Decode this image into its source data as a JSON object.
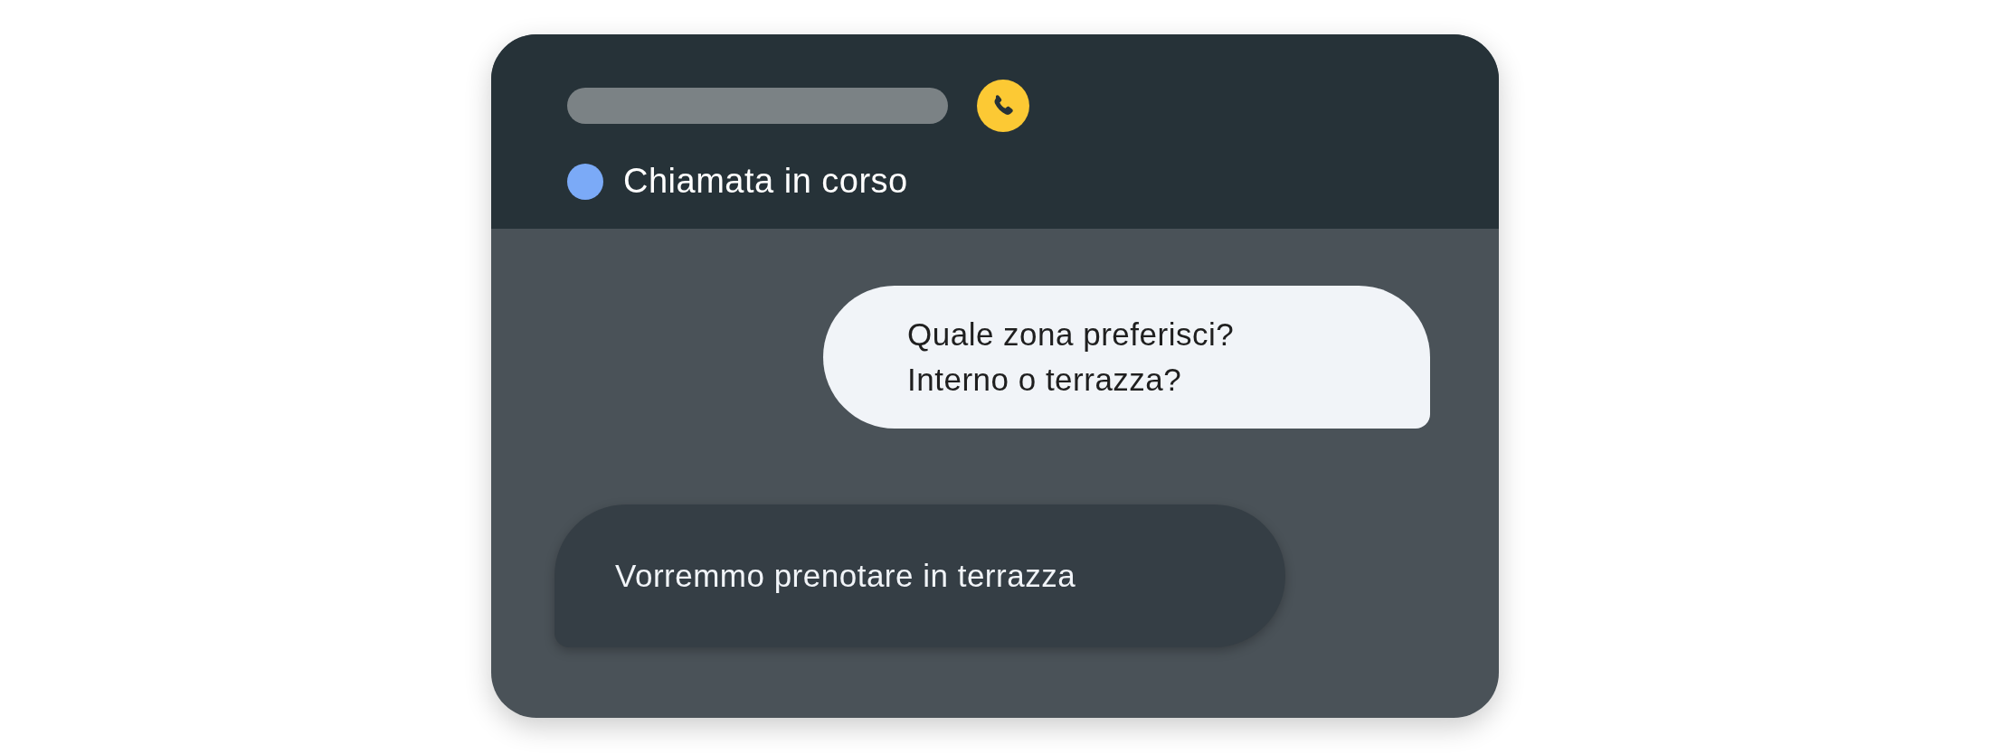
{
  "call_header": {
    "status": "Chiamata in corso"
  },
  "messages": [
    {
      "kind": "incoming",
      "text": "Quale zona preferisci?\nInterno o terrazza?"
    },
    {
      "kind": "outgoing",
      "text": "Vorremmo prenotare in terrazza"
    }
  ]
}
